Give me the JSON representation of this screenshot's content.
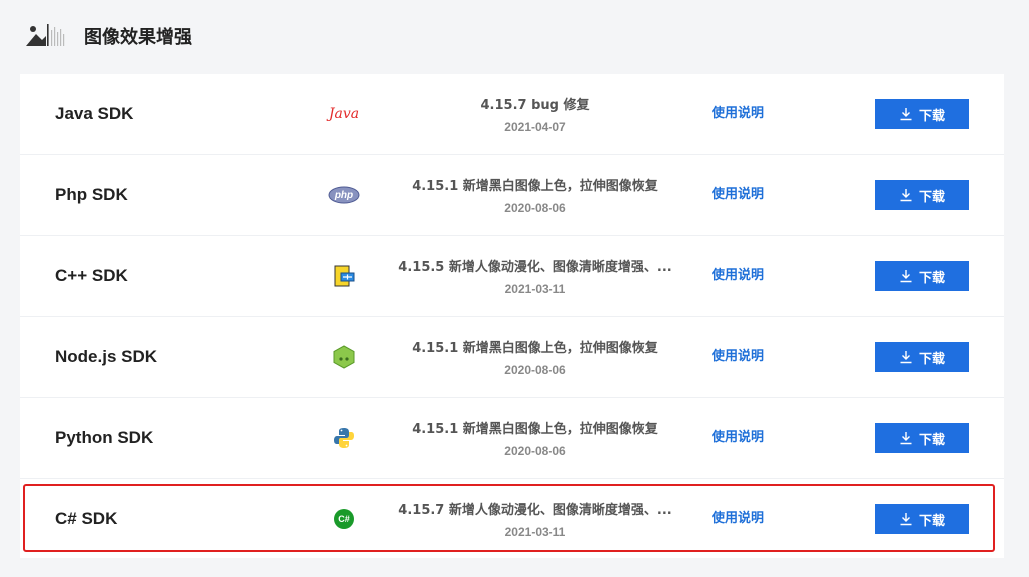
{
  "header": {
    "title": "图像效果增强",
    "logo_icon": "image-waveform-logo-icon"
  },
  "rows": [
    {
      "name": "Java SDK",
      "icon": "java-icon",
      "icon_text": "Java",
      "version": "4.15.7 bug 修复",
      "date": "2021-04-07",
      "doc_label": "使用说明",
      "download_label": "下载"
    },
    {
      "name": "Php SDK",
      "icon": "php-icon",
      "icon_text": "php",
      "version": "4.15.1 新增黑白图像上色，拉伸图像恢复",
      "date": "2020-08-06",
      "doc_label": "使用说明",
      "download_label": "下载"
    },
    {
      "name": "C++ SDK",
      "icon": "cpp-icon",
      "icon_text": "",
      "version": "4.15.5 新增人像动漫化、图像清晰度增强、...",
      "date": "2021-03-11",
      "doc_label": "使用说明",
      "download_label": "下载"
    },
    {
      "name": "Node.js SDK",
      "icon": "nodejs-icon",
      "icon_text": "",
      "version": "4.15.1 新增黑白图像上色，拉伸图像恢复",
      "date": "2020-08-06",
      "doc_label": "使用说明",
      "download_label": "下载"
    },
    {
      "name": "Python SDK",
      "icon": "python-icon",
      "icon_text": "",
      "version": "4.15.1 新增黑白图像上色，拉伸图像恢复",
      "date": "2020-08-06",
      "doc_label": "使用说明",
      "download_label": "下载"
    },
    {
      "name": "C# SDK",
      "icon": "csharp-icon",
      "icon_text": "C#",
      "version": "4.15.7 新增人像动漫化、图像清晰度增强、...",
      "date": "2021-03-11",
      "doc_label": "使用说明",
      "download_label": "下载"
    }
  ],
  "colors": {
    "accent": "#1f6fe0",
    "link": "#1e6fd8",
    "highlight": "#e02020"
  }
}
